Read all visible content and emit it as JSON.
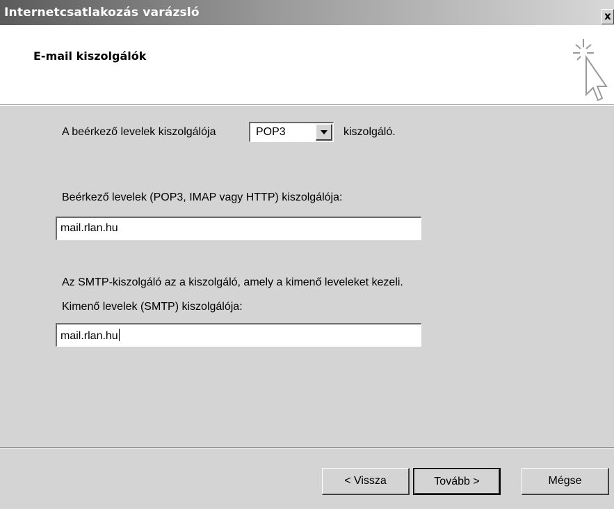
{
  "window": {
    "title": "Internetcsatlakozás varázsló",
    "close_label": "x"
  },
  "header": {
    "heading": "E-mail kiszolgálók",
    "icon": "wizard-cursor-icon"
  },
  "form": {
    "incoming_type_prefix": "A beérkező levelek kiszolgálója",
    "incoming_type_value": "POP3",
    "incoming_type_suffix": "kiszolgáló.",
    "incoming_server_label": "Beérkező levelek (POP3, IMAP vagy HTTP) kiszolgálója:",
    "incoming_server_value": "mail.rlan.hu",
    "smtp_info": "Az SMTP-kiszolgáló az a kiszolgáló, amely a kimenő leveleket kezeli.",
    "outgoing_server_label": "Kimenő levelek (SMTP) kiszolgálója:",
    "outgoing_server_value": "mail.rlan.hu"
  },
  "buttons": {
    "back": "< Vissza",
    "next": "Tovább >",
    "cancel": "Mégse"
  }
}
